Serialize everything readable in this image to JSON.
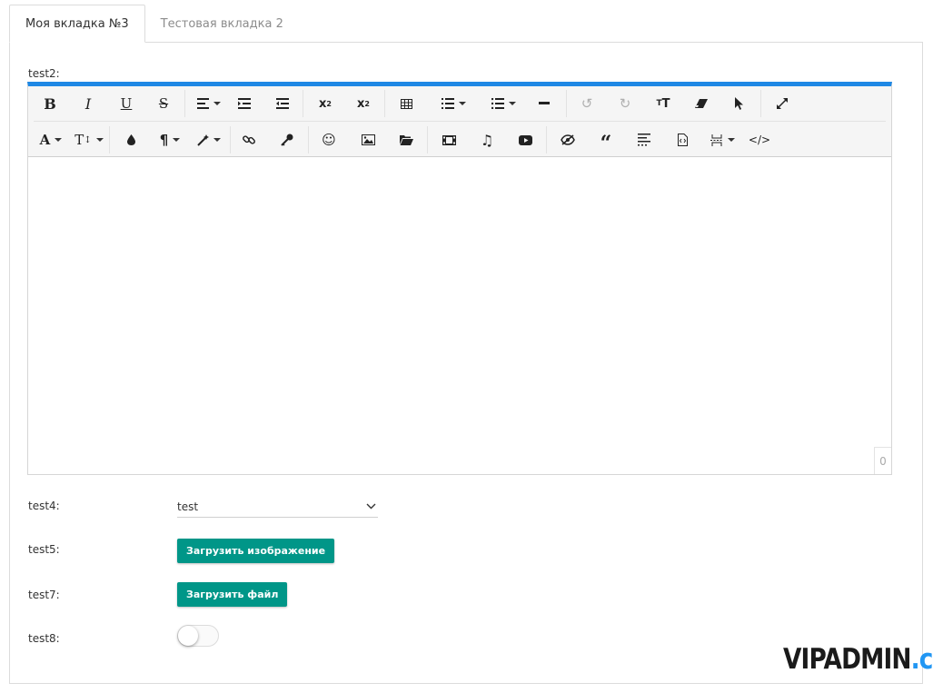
{
  "tabs": [
    {
      "label": "Моя вкладка №3",
      "active": true
    },
    {
      "label": "Тестовая вкладка 2",
      "active": false
    }
  ],
  "editor": {
    "label": "test2:",
    "char_count": "0",
    "toolbar_row1": [
      "bold-icon",
      "italic-icon",
      "underline-icon",
      "strikethrough-icon",
      "align-icon",
      "indent-icon",
      "outdent-icon",
      "subscript-icon",
      "superscript-icon",
      "table-icon",
      "ordered-list-icon",
      "unordered-list-icon",
      "horizontal-rule-icon",
      "undo-icon",
      "redo-icon",
      "text-case-icon",
      "eraser-icon",
      "select-pointer-icon",
      "fullscreen-icon"
    ],
    "toolbar_row2": [
      "font-color-icon",
      "font-size-icon",
      "ink-drop-icon",
      "paragraph-icon",
      "magic-wand-icon",
      "link-icon",
      "key-icon",
      "smiley-icon",
      "image-icon",
      "folder-open-icon",
      "video-film-icon",
      "music-note-icon",
      "youtube-icon",
      "hidden-eye-icon",
      "quote-icon",
      "text-lines-icon",
      "file-code-icon",
      "page-break-icon",
      "source-code-icon"
    ],
    "accent_color": "#1e88e5"
  },
  "fields": {
    "test4": {
      "label": "test4:",
      "value": "test"
    },
    "test5": {
      "label": "test5:",
      "button": "Загрузить изображение"
    },
    "test7": {
      "label": "test7:",
      "button": "Загрузить файл"
    },
    "test8": {
      "label": "test8:",
      "toggle_on": false
    }
  },
  "colors": {
    "button": "#009688",
    "border": "#dcdcdc"
  },
  "watermark": {
    "part1": "VIPADMIN",
    "part2": ".club"
  }
}
